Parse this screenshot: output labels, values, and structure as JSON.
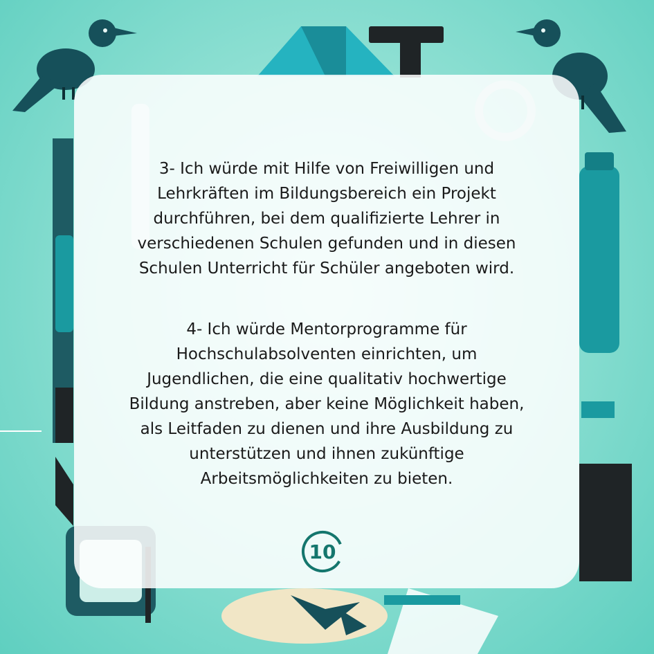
{
  "paragraphs": [
    "3- Ich würde mit Hilfe von Freiwilligen und\nLehrkräften im Bildungsbereich ein Projekt\ndurchführen, bei dem qualifizierte Lehrer in\nverschiedenen Schulen gefunden und in diesen\nSchulen Unterricht für Schüler angeboten wird.",
    "4- Ich würde Mentorprogramme für\nHochschulabsolventen einrichten, um\nJugendlichen, die eine qualitativ hochwertige\nBildung anstreben, aber keine Möglichkeit haben,\nals Leitfaden zu dienen und ihre Ausbildung zu\nunterstützen und ihnen zukünftige\nArbeitsmöglichkeiten zu bieten."
  ],
  "page_number": "10",
  "colors": {
    "background": "#8fe0d3",
    "teal_accent": "#1a9aa0",
    "dark_teal": "#0f4d57",
    "badge": "#14766d"
  },
  "decorations": [
    "crow-illustration",
    "crow-illustration",
    "bottle-illustration",
    "book-illustration",
    "pencil-illustration"
  ]
}
